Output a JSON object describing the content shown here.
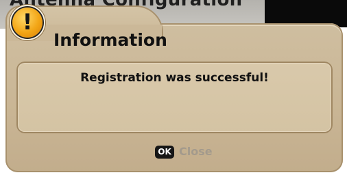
{
  "background": {
    "title": "Antenna Configuration"
  },
  "dialog": {
    "icon": "exclamation-icon",
    "icon_glyph": "!",
    "title": "Information",
    "message": "Registration was successful!",
    "accent_color": "#f2a516",
    "ok_key": "OK",
    "close_label": "Close"
  }
}
